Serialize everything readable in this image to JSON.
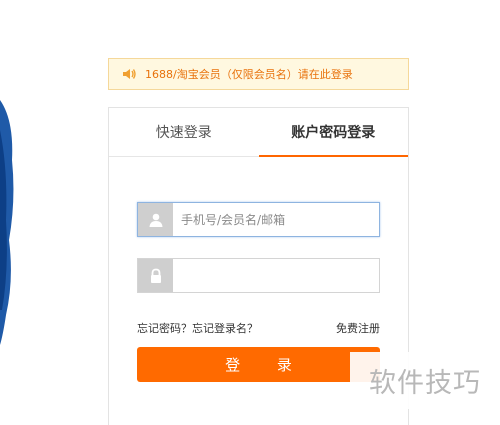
{
  "notice": {
    "icon": "speaker-icon",
    "text": "1688/淘宝会员（仅限会员名）请在此登录",
    "color": "#e8720c"
  },
  "tabs": [
    {
      "label": "快速登录",
      "active": false
    },
    {
      "label": "账户密码登录",
      "active": true
    }
  ],
  "form": {
    "username": {
      "icon": "user-icon",
      "placeholder": "手机号/会员名/邮箱",
      "value": ""
    },
    "password": {
      "icon": "lock-icon",
      "placeholder": "",
      "value": ""
    },
    "forgot_text": "忘记密码？忘记登录名？",
    "register_text": "免费注册",
    "login_button": "登 录"
  },
  "watermark": {
    "text": "软件技巧"
  },
  "colors": {
    "accent": "#ff6a00",
    "tab_underline": "#ff6600",
    "notice_bg": "#fff8e0"
  }
}
